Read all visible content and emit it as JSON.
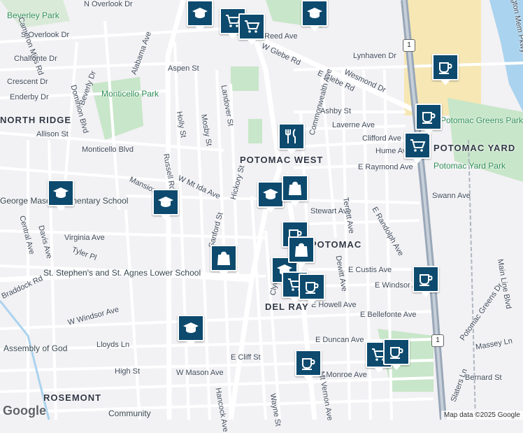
{
  "map": {
    "neighborhoods": [
      "NORTH RIDGE",
      "POTOMAC WEST",
      "POTOMAC YARD",
      "POTOMAC",
      "DEL RAY",
      "ROSEMONT"
    ],
    "parks": [
      "Beverley Park",
      "Monticello Park",
      "Potomac Greens Park",
      "Potomac Yard Park"
    ],
    "places": [
      "George Mason Elementary School",
      "St. Stephen's and St. Agnes Lower School",
      "Assembly of God",
      "Community"
    ],
    "streets": [
      "N Overlook Dr",
      "S Overlook Dr",
      "Cameron Mills Rd",
      "Chalfonte Dr",
      "Alabama Ave",
      "Aspen St",
      "Crescent Dr",
      "Enderby Dr",
      "Beverly Dr",
      "Dominion Blvd",
      "Allison St",
      "Monticello Blvd",
      "Holly St",
      "Mosby St",
      "Landover St",
      "Russell Rd",
      "Reed Ave",
      "W Glebe Rd",
      "E Glebe Rd",
      "Lynhaven Dr",
      "Wesmond Dr",
      "Commonwealth Ave",
      "Ashby St",
      "Laverne Ave",
      "Clifford Ave",
      "Hume Ave",
      "E Raymond Ave",
      "Mansion Dr",
      "W Mt Ida Ave",
      "Hickory St",
      "Stewart Ave",
      "Terrett Ave",
      "E Randolph Ave",
      "Swann Ave",
      "Sanford St",
      "Virginia Ave",
      "Davis Ave",
      "Central Ave",
      "Tyler Pl",
      "Braddock Rd",
      "Clyde Ave",
      "Dewitt Ave",
      "E Custis Ave",
      "E Windsor Ave",
      "Main Line Blvd",
      "E Howell Ave",
      "W Windsor Ave",
      "E Bellefonte Ave",
      "Potomac Greens Dr",
      "Massey Ln",
      "Lloyds Ln",
      "E Duncan Ave",
      "E Cliff St",
      "High St",
      "W Mason Ave",
      "E Monroe Ave",
      "Slaters Ln",
      "Bernard St",
      "Mt Vernon Ave",
      "Wayne St",
      "Hancock Ave",
      "Arlington Mem Pkwy"
    ],
    "route_shields": [
      "1",
      "1"
    ],
    "markers": [
      {
        "type": "school",
        "icon": "graduation-cap-icon"
      },
      {
        "type": "school",
        "icon": "graduation-cap-icon"
      },
      {
        "type": "school",
        "icon": "graduation-cap-icon"
      },
      {
        "type": "school",
        "icon": "graduation-cap-icon"
      },
      {
        "type": "school",
        "icon": "graduation-cap-icon"
      },
      {
        "type": "school",
        "icon": "graduation-cap-icon"
      },
      {
        "type": "school",
        "icon": "graduation-cap-icon"
      },
      {
        "type": "grocery",
        "icon": "shopping-cart-icon"
      },
      {
        "type": "grocery",
        "icon": "shopping-cart-icon"
      },
      {
        "type": "grocery",
        "icon": "shopping-cart-icon"
      },
      {
        "type": "grocery",
        "icon": "shopping-cart-icon"
      },
      {
        "type": "grocery",
        "icon": "shopping-cart-icon"
      },
      {
        "type": "restaurant",
        "icon": "fork-knife-icon"
      },
      {
        "type": "cafe",
        "icon": "coffee-cup-icon"
      },
      {
        "type": "cafe",
        "icon": "coffee-cup-icon"
      },
      {
        "type": "cafe",
        "icon": "coffee-cup-icon"
      },
      {
        "type": "cafe",
        "icon": "coffee-cup-icon"
      },
      {
        "type": "cafe",
        "icon": "coffee-cup-icon"
      },
      {
        "type": "cafe",
        "icon": "coffee-cup-icon"
      },
      {
        "type": "cafe",
        "icon": "coffee-cup-icon"
      },
      {
        "type": "shopping",
        "icon": "shopping-bag-icon"
      },
      {
        "type": "shopping",
        "icon": "shopping-bag-icon"
      },
      {
        "type": "shopping",
        "icon": "shopping-bag-icon"
      }
    ]
  },
  "branding": {
    "logo": "Google",
    "attribution": "Map data ©2025 Google"
  },
  "colors": {
    "marker": "#0d4a6e",
    "park": "#c8e6c9",
    "highway": "#9aa8b8",
    "water": "#a9d3ee",
    "retail": "#f6e7b4"
  }
}
